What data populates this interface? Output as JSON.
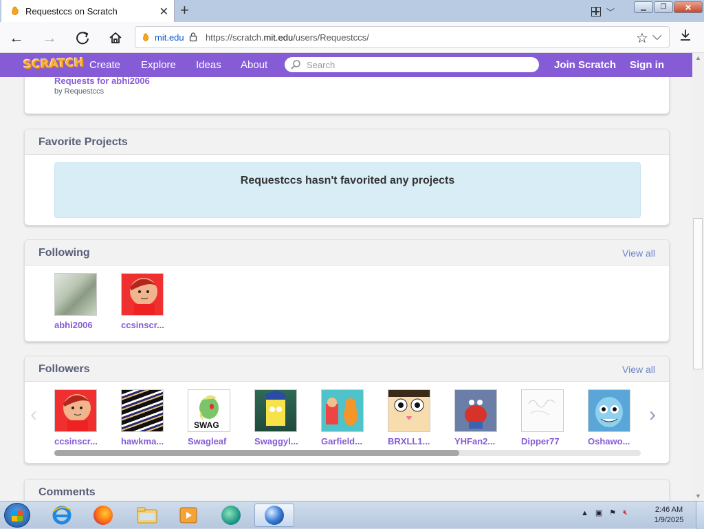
{
  "browser": {
    "tab_title": "Requestccs on Scratch",
    "url_site": "mit.edu",
    "url_prefix": "https://scratch.",
    "url_domain": "mit.edu",
    "url_path": "/users/Requestccs/"
  },
  "scratch_nav": {
    "logo": "SCRATCH",
    "links": [
      "Create",
      "Explore",
      "Ideas",
      "About"
    ],
    "search_placeholder": "Search",
    "join": "Join Scratch",
    "sign_in": "Sign in",
    "color": "#855cd6"
  },
  "shared_project": {
    "title": "Requests for abhi2006",
    "byline": "by Requestccs"
  },
  "favorites": {
    "heading": "Favorite Projects",
    "empty_message": "Requestccs hasn't favorited any projects"
  },
  "following": {
    "heading": "Following",
    "view_all": "View all",
    "users": [
      "abhi2006",
      "ccsinscr..."
    ]
  },
  "followers": {
    "heading": "Followers",
    "view_all": "View all",
    "users": [
      "ccsinscr...",
      "hawkma...",
      "Swagleaf",
      "Swaggyl...",
      "Garfield...",
      "BRXLL1...",
      "YHFan2...",
      "Dipper77",
      "Oshawo..."
    ],
    "swag_text": "SWAG",
    "scroll_position": 0.69
  },
  "comments": {
    "heading": "Comments"
  },
  "taskbar": {
    "time": "2:46 AM",
    "date": "1/9/2025"
  }
}
